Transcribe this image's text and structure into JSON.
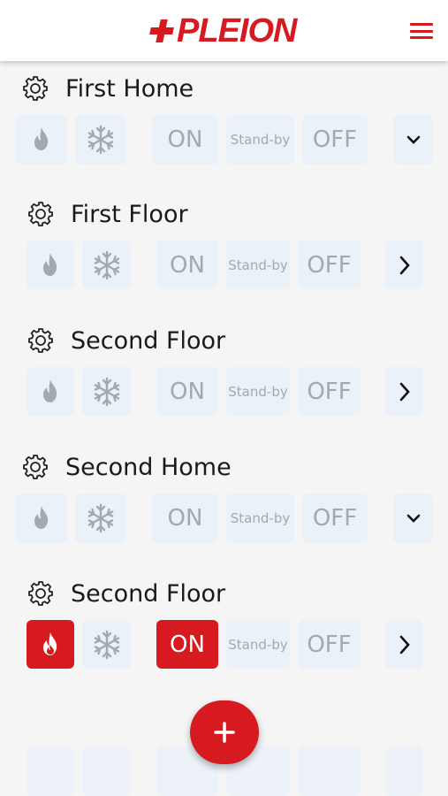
{
  "app": {
    "brand": "PLEION",
    "brand_color": "#d71920",
    "icons": {
      "menu": "hamburger-menu-icon",
      "settings": "gear-icon",
      "heat": "flame-icon",
      "cool": "snowflake-icon",
      "expand": "chevron-down-icon",
      "open": "chevron-right-icon",
      "add": "plus-icon"
    }
  },
  "groups": [
    {
      "title": "First Home",
      "on": "ON",
      "standby": "Stand-by",
      "off": "OFF",
      "active": "none",
      "toggle": "chevron-down-icon"
    },
    {
      "title": "First Floor",
      "on": "ON",
      "standby": "Stand-by",
      "off": "OFF",
      "active": "none",
      "toggle": "chevron-right-icon"
    },
    {
      "title": "Second Floor",
      "on": "ON",
      "standby": "Stand-by",
      "off": "OFF",
      "active": "none",
      "toggle": "chevron-right-icon"
    },
    {
      "title": "Second Home",
      "on": "ON",
      "standby": "Stand-by",
      "off": "OFF",
      "active": "none",
      "toggle": "chevron-down-icon"
    },
    {
      "title": "Second Floor",
      "on": "ON",
      "standby": "Stand-by",
      "off": "OFF",
      "active": "heat+on",
      "toggle": "chevron-right-icon"
    }
  ]
}
